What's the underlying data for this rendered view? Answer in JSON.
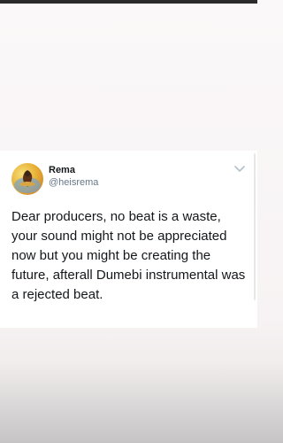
{
  "tweet": {
    "display_name": "Rema",
    "handle": "@heisrema",
    "text": "Dear producers, no beat is a waste, your sound might not be appreciated now but you might be creating the future, afterall Dumebi instrumental was a rejected beat."
  },
  "icons": {
    "avatar": "profile-photo",
    "menu": "chevron-down-icon"
  }
}
